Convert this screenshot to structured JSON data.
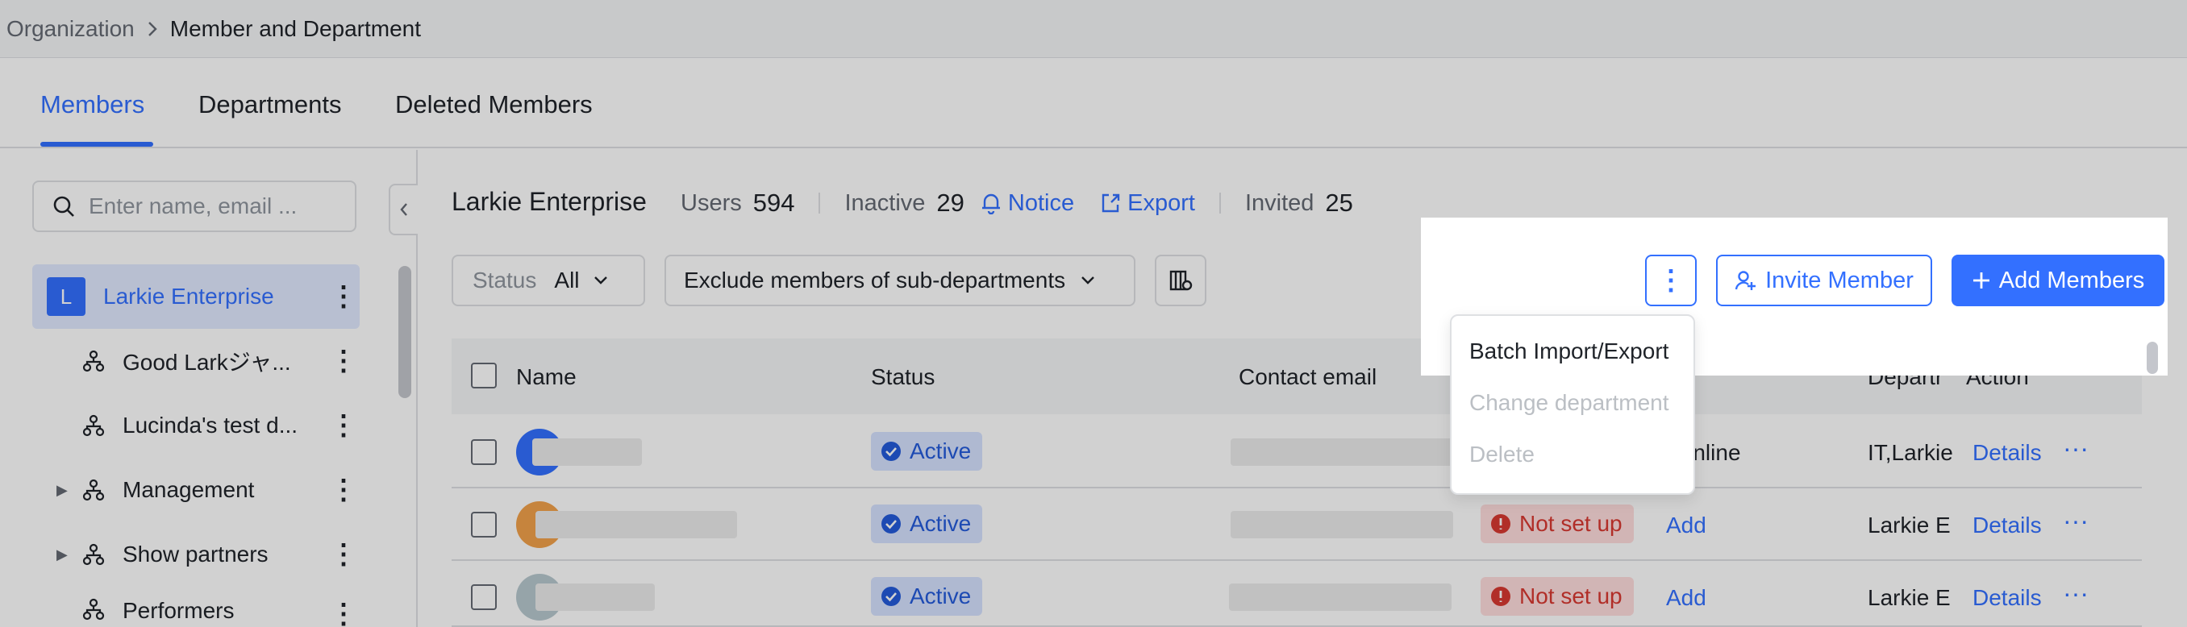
{
  "breadcrumb": {
    "root": "Organization",
    "current": "Member and Department"
  },
  "tabs": [
    "Members",
    "Departments",
    "Deleted Members"
  ],
  "sidebar": {
    "search_placeholder": "Enter name, email ...",
    "items": [
      {
        "avatar_letter": "L",
        "label": "Larkie Enterprise"
      },
      {
        "label": "Good Larkジャ..."
      },
      {
        "label": "Lucinda's test d..."
      },
      {
        "label": "Management"
      },
      {
        "label": "Show partners"
      },
      {
        "label": "Performers"
      }
    ]
  },
  "header": {
    "title": "Larkie Enterprise",
    "users_label": "Users",
    "users_count": "594",
    "inactive_label": "Inactive",
    "inactive_count": "29",
    "notice": "Notice",
    "export": "Export",
    "invited_label": "Invited",
    "invited_count": "25"
  },
  "filters": {
    "status_label": "Status",
    "status_value": "All",
    "dept_filter": "Exclude members of sub-departments"
  },
  "actions": {
    "invite": "Invite Member",
    "add": "Add Members"
  },
  "menu": {
    "items": [
      "Batch Import/Export",
      "Change department",
      "Delete"
    ]
  },
  "table": {
    "columns": [
      "Name",
      "Status",
      "Contact email",
      "Departr",
      "Action"
    ],
    "rows": [
      {
        "status": "Active",
        "extra": ".online",
        "dept": "IT,Larkie",
        "details": "Details"
      },
      {
        "status": "Active",
        "setup": "Not set up",
        "add": "Add",
        "dept": "Larkie E",
        "details": "Details"
      },
      {
        "status": "Active",
        "setup": "Not set up",
        "add": "Add",
        "dept": "Larkie E",
        "details": "Details"
      }
    ]
  },
  "colors": {
    "accent": "#3370ff",
    "active_badge": "#d6e2ff",
    "warn_badge": "#ffdddd"
  }
}
